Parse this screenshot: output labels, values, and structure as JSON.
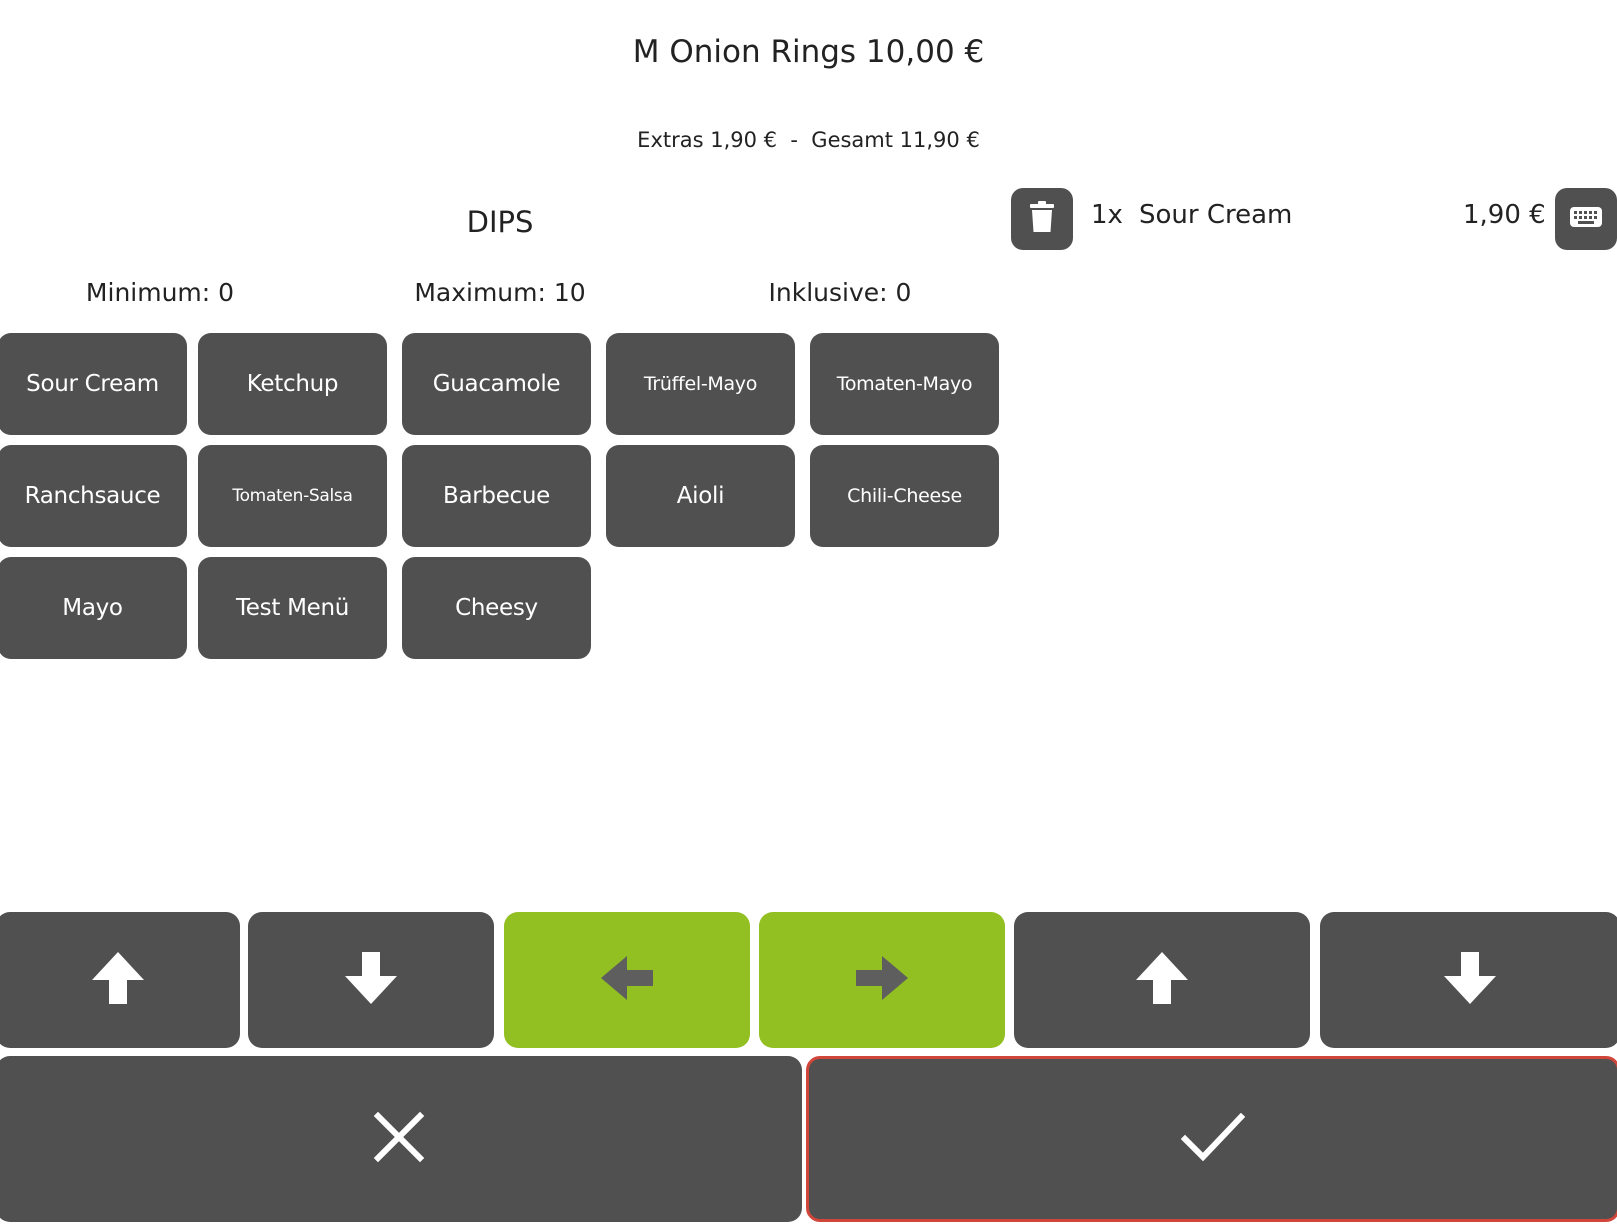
{
  "product": {
    "title": "M Onion Rings 10,00 €"
  },
  "totals": {
    "text": "Extras 1,90 €  -  Gesamt 11,90 €"
  },
  "group": {
    "title": "DIPS",
    "minimum": "Minimum: 0",
    "maximum": "Maximum: 10",
    "inclusive": "Inklusive: 0"
  },
  "dips": [
    "Sour Cream",
    "Ketchup",
    "Guacamole",
    "Trüffel-Mayo",
    "Tomaten-Mayo",
    "Ranchsauce",
    "Tomaten-Salsa",
    "Barbecue",
    "Aioli",
    "Chili-Cheese",
    "Mayo",
    "Test Menü",
    "Cheesy"
  ],
  "selected": [
    {
      "qty": "1x",
      "name": "Sour Cream",
      "price": "1,90 €"
    }
  ],
  "icons": {
    "delete": "trash-icon",
    "keyboard": "keyboard-icon",
    "up": "arrow-up-icon",
    "down": "arrow-down-icon",
    "left": "arrow-left-icon",
    "right": "arrow-right-icon",
    "cancel": "close-icon",
    "confirm": "check-icon"
  },
  "colors": {
    "button": "#505050",
    "accent_green": "#92bf22",
    "focus_border": "#d0463a"
  }
}
